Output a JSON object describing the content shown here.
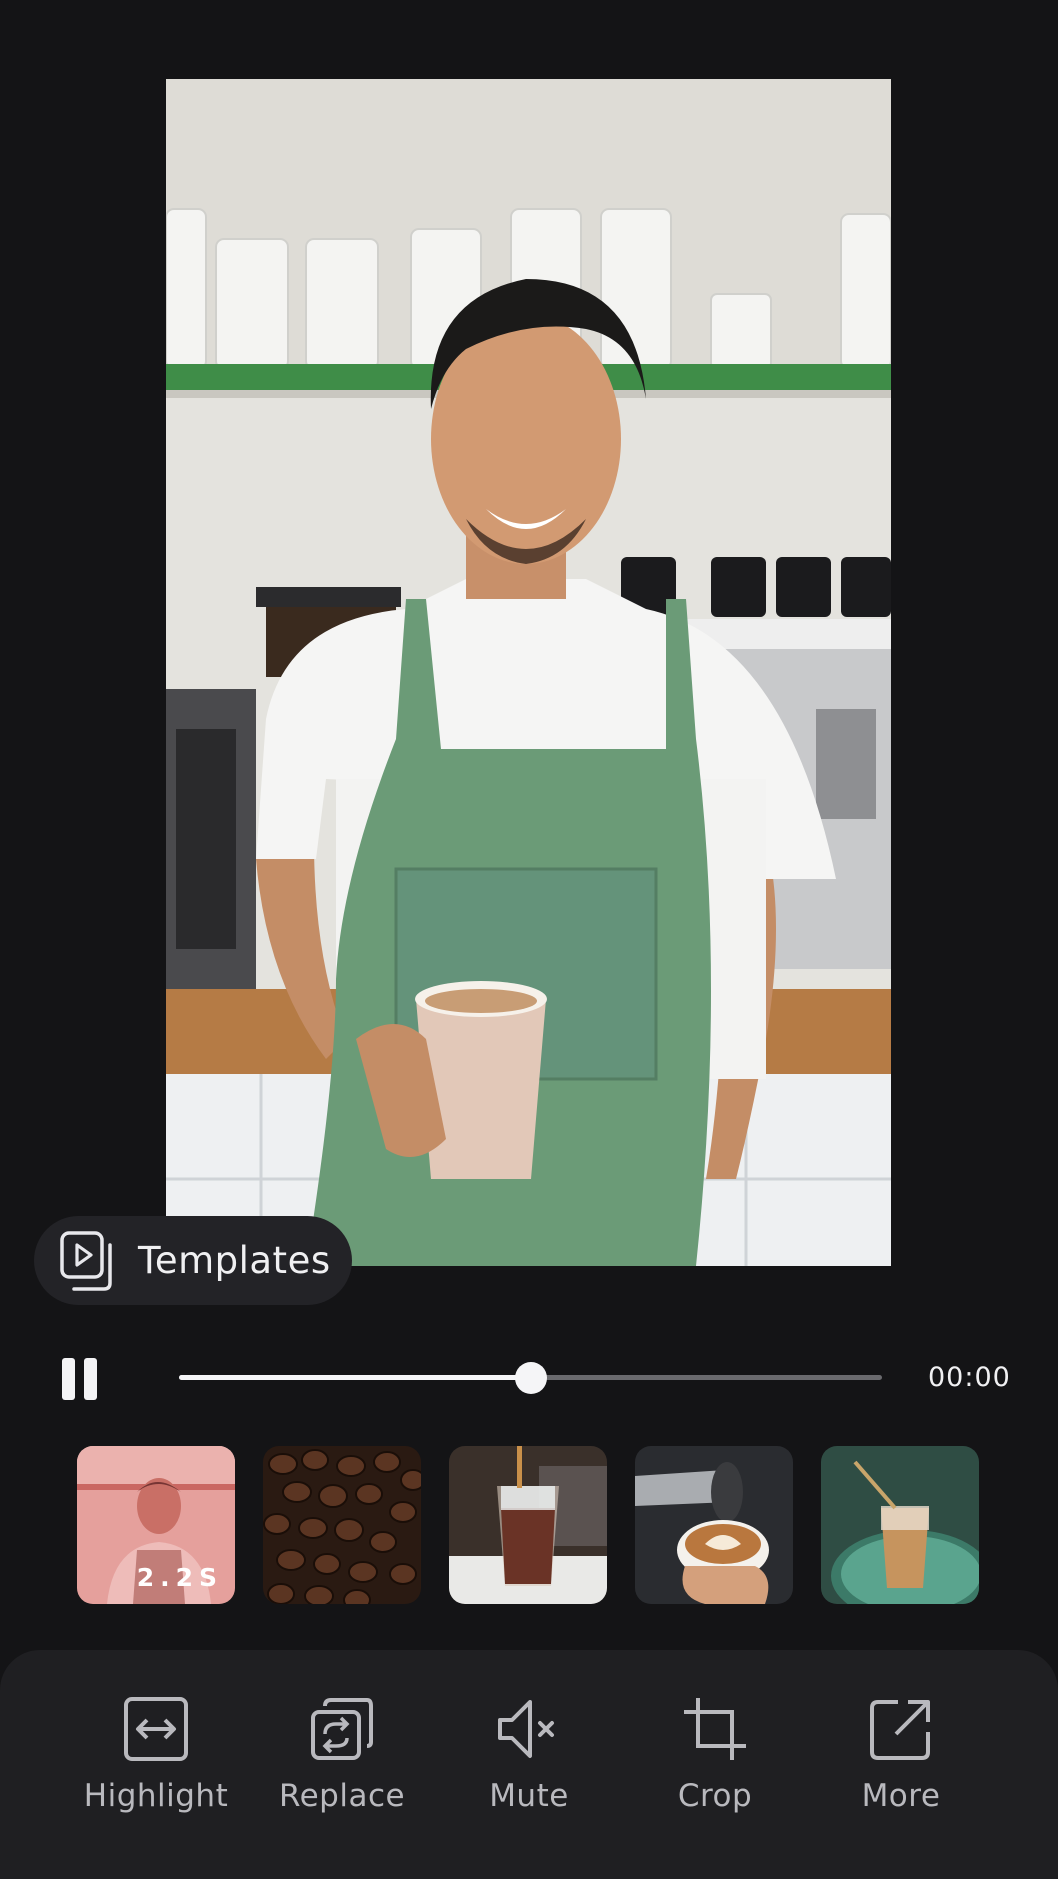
{
  "preview": {
    "description_icon": "video-preview"
  },
  "templates": {
    "label": "Templates",
    "icon": "templates-icon"
  },
  "playback": {
    "state_icon": "pause-icon",
    "progress": 0.5,
    "time": "00:00"
  },
  "clips": [
    {
      "name": "barista-clip",
      "duration": "2.2S",
      "selected": true
    },
    {
      "name": "coffee-beans-clip"
    },
    {
      "name": "iced-coffee-clip"
    },
    {
      "name": "latte-art-clip"
    },
    {
      "name": "iced-latte-clip"
    }
  ],
  "toolbar": {
    "items": [
      {
        "label": "Highlight",
        "icon": "highlight-icon"
      },
      {
        "label": "Replace",
        "icon": "replace-icon"
      },
      {
        "label": "Mute",
        "icon": "mute-icon"
      },
      {
        "label": "Crop",
        "icon": "crop-icon"
      },
      {
        "label": "More",
        "icon": "share-icon"
      }
    ]
  },
  "colors": {
    "background": "#141416",
    "toolbar": "#1f1f22",
    "pill": "#232327",
    "accent": "#f5f5f7",
    "selected_clip_tint": "#e06060"
  }
}
